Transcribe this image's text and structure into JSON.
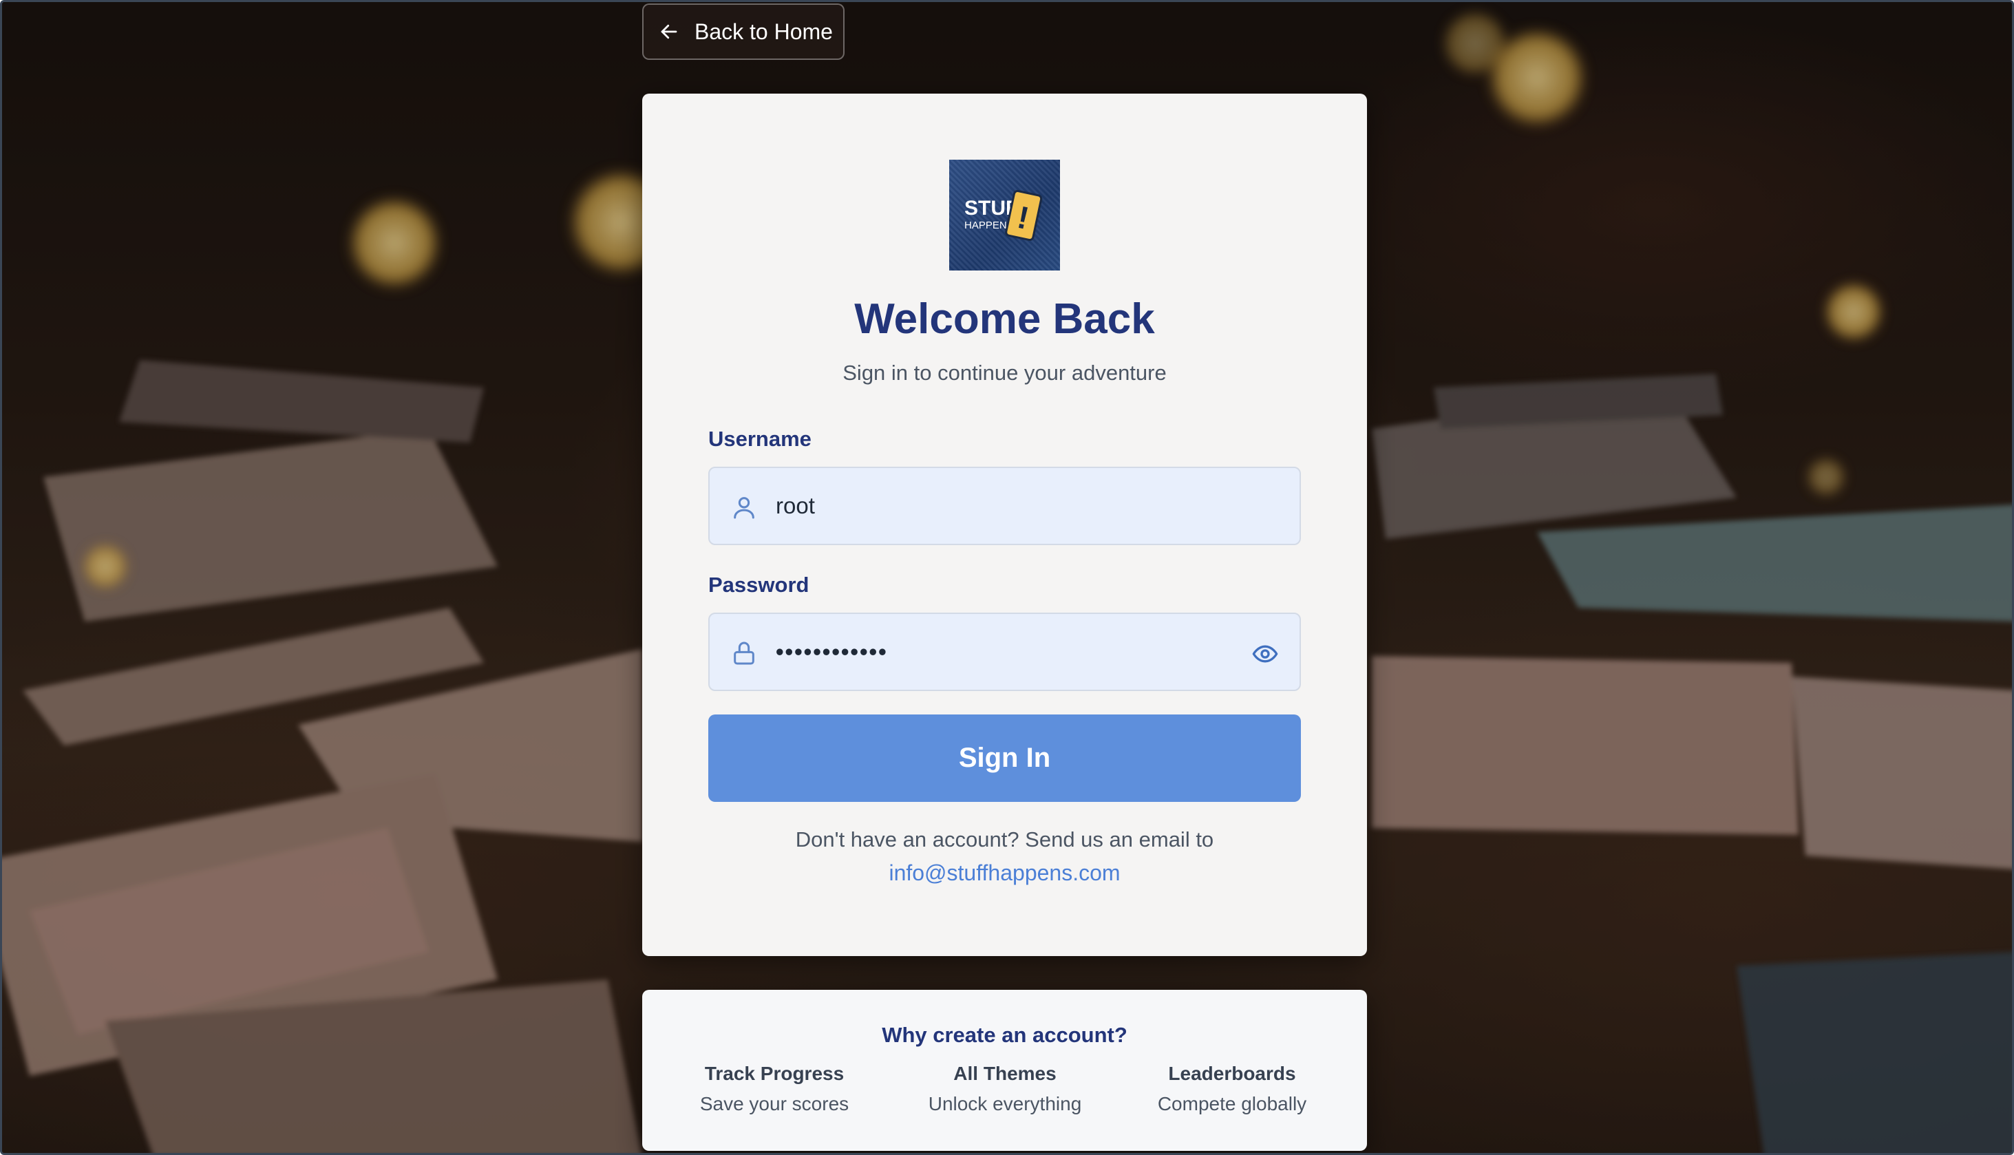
{
  "nav": {
    "back_label": "Back to Home"
  },
  "login": {
    "logo_text_line1": "STUFF",
    "logo_text_line2": "HAPPENS",
    "logo_mark": "!",
    "title": "Welcome Back",
    "subtitle": "Sign in to continue your adventure",
    "username_label": "Username",
    "username_value": "root",
    "password_label": "Password",
    "password_value": "••••••••••••",
    "submit_label": "Sign In",
    "signup_prompt": "Don't have an account? Send us an email to",
    "contact_email": "info@stuffhappens.com"
  },
  "benefits": {
    "title": "Why create an account?",
    "items": [
      {
        "name": "Track Progress",
        "desc": "Save your scores"
      },
      {
        "name": "All Themes",
        "desc": "Unlock everything"
      },
      {
        "name": "Leaderboards",
        "desc": "Compete globally"
      }
    ]
  },
  "icons": {
    "back": "arrow-left-icon",
    "username": "user-icon",
    "password": "lock-icon",
    "reveal": "eye-icon"
  },
  "colors": {
    "primary_text": "#23357a",
    "button": "#5e8fdc",
    "link": "#4b7fd6",
    "input_bg": "#e8effc",
    "card_bg": "#f5f4f3"
  }
}
